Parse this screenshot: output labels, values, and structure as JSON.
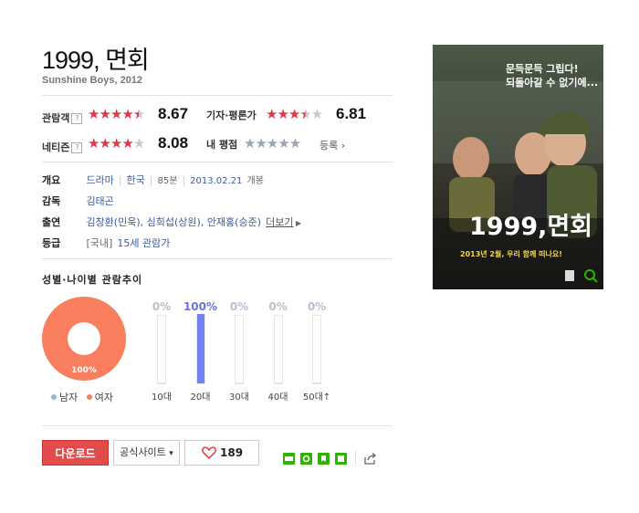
{
  "movie": {
    "title": "1999, 면회",
    "subtitle": "Sunshine Boys, 2012"
  },
  "ratings": {
    "audience": {
      "label": "관람객",
      "help": "?",
      "score": "8.67",
      "stars": 4.5
    },
    "critic": {
      "label": "기자·평론가",
      "score": "6.81",
      "stars": 3.5
    },
    "netizen": {
      "label": "네티즌",
      "help": "?",
      "score": "8.08",
      "stars": 4.0
    },
    "mine": {
      "label": "내 평점",
      "register": "등록 ›"
    }
  },
  "info": {
    "overview_label": "개요",
    "genre": "드라마",
    "country": "한국",
    "runtime": "85분",
    "release": "2013.02.21",
    "release_suffix": "개봉",
    "director_label": "감독",
    "director": "김태곤",
    "cast_label": "출연",
    "cast": [
      "김창환(민욱)",
      "심희섭(상원)",
      "안재홍(승준)"
    ],
    "cast_more": "더보기",
    "grade_label": "등급",
    "grade_country": "[국내]",
    "grade": "15세 관람가"
  },
  "trend": {
    "title": "성별·나이별 관람추이",
    "gender_donut_label": "100%",
    "legend": {
      "male": "남자",
      "female": "여자"
    },
    "colors": {
      "male": "#8fb6e0",
      "female": "#f87e5d",
      "bar": "#7282f0"
    }
  },
  "chart_data": {
    "type": "bar",
    "categories": [
      "10대",
      "20대",
      "30대",
      "40대",
      "50대↑"
    ],
    "values": [
      0,
      100,
      0,
      0,
      0
    ],
    "value_labels": [
      "0%",
      "100%",
      "0%",
      "0%",
      "0%"
    ],
    "ylim": [
      0,
      100
    ]
  },
  "actions": {
    "download": "다운로드",
    "official_site": "공식사이트",
    "site_caret": "▾",
    "likes": "189"
  },
  "poster": {
    "tagline_1": "문득문득 그립다!",
    "tagline_2": "되돌아갈 수 없기에...",
    "title_art": "1999,면회",
    "release_banner": "2013년 2월, 우리 함께 떠나요!"
  }
}
